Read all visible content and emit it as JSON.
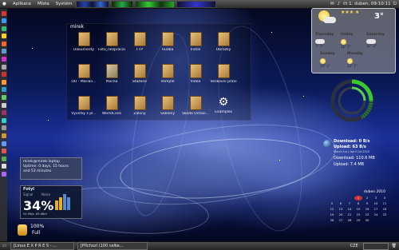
{
  "top_panel": {
    "menus": [
      "Aplikace",
      "Místa",
      "Systém"
    ],
    "clock": "čt 1. duben, 09:10:11"
  },
  "folder_window": {
    "title": "mirek",
    "items": [
      {
        "label": "Dokumenty",
        "kind": "folder"
      },
      {
        "label": "Foto_nezpracov...",
        "kind": "folder"
      },
      {
        "label": "FTP",
        "kind": "folder"
      },
      {
        "label": "Hudba",
        "kind": "folder"
      },
      {
        "label": "Instal",
        "kind": "folder"
      },
      {
        "label": "Obrázky",
        "kind": "folder"
      },
      {
        "label": "OÚ - Marián...",
        "kind": "folder"
      },
      {
        "label": "Plocha",
        "kind": "desktop"
      },
      {
        "label": "Stažené",
        "kind": "folder"
      },
      {
        "label": "Veřejné",
        "kind": "folder"
      },
      {
        "label": "Videa",
        "kind": "folder"
      },
      {
        "label": "Venkovní přání",
        "kind": "folder"
      },
      {
        "label": "Vyúčtky z pl...",
        "kind": "folder"
      },
      {
        "label": "WorldCons",
        "kind": "folder"
      },
      {
        "label": "Zálony",
        "kind": "folder"
      },
      {
        "label": "Šablony",
        "kind": "folder"
      },
      {
        "label": "Škoda Octavi...",
        "kind": "folder"
      },
      {
        "label": "Examples",
        "kind": "gear"
      }
    ]
  },
  "weather": {
    "temperature": "3°",
    "days": [
      {
        "name": "Thursday",
        "hi": "7°",
        "lo": "1°"
      },
      {
        "name": "Friday",
        "hi": "11°",
        "lo": "1°"
      },
      {
        "name": "Saturday",
        "hi": "11°",
        "lo": "2°"
      },
      {
        "name": "Sunday",
        "hi": "15°",
        "lo": "2°"
      },
      {
        "name": "Monday",
        "hi": "12°",
        "lo": "1°"
      }
    ]
  },
  "network": {
    "download_speed": "Download: 0 B/s",
    "upload_speed": "Upload: 63 B/s",
    "date_line": "March 1st | April 1st 2010",
    "download_total": "Download: 110.6 MB",
    "upload_total": "Upload: 7.4 MB"
  },
  "info_box": {
    "line1": "mirek@mirek-laptop",
    "line2": "Uptime: 0 days, 15 hours",
    "line3": "and 53 minutes"
  },
  "wifi": {
    "title": "Fotyl",
    "signal_label": "Signal",
    "noise_label": "Noise",
    "percent": "34%",
    "details": "54 Mb/s  -85 dBm"
  },
  "battery": {
    "percent": "100%",
    "status": "Full"
  },
  "calendar": {
    "month": "duben 2010",
    "today": "1",
    "days": [
      "",
      "",
      "",
      "1",
      "2",
      "3",
      "4",
      "5",
      "6",
      "7",
      "8",
      "9",
      "10",
      "11",
      "12",
      "13",
      "14",
      "15",
      "16",
      "17",
      "18",
      "19",
      "20",
      "21",
      "22",
      "23",
      "24",
      "25",
      "26",
      "27",
      "28",
      "29",
      "30",
      "",
      ""
    ]
  },
  "bottom_panel": {
    "tasks": [
      "[Linux E X P R E S - ...",
      "[Příchozí (100 celke..."
    ],
    "keyboard_layout": "CZE"
  },
  "colors": {
    "folder": "#c89a52",
    "accent_green": "#39c92c",
    "today_red": "#d03030"
  }
}
